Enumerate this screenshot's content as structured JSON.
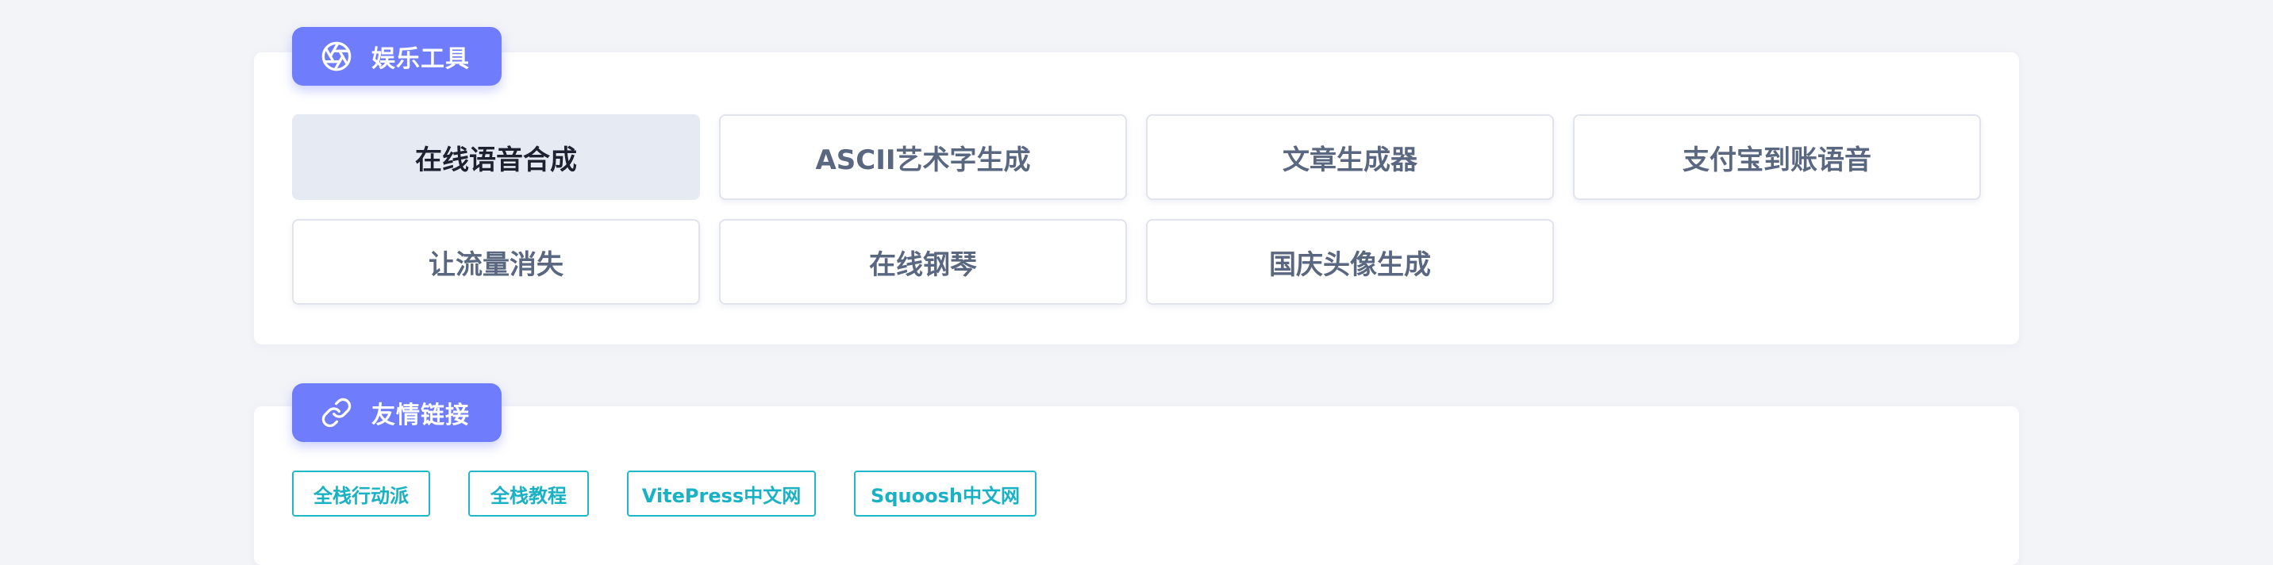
{
  "entertainment": {
    "title": "娱乐工具",
    "icon": "aperture-icon",
    "items": [
      {
        "label": "在线语音合成",
        "active": true
      },
      {
        "label": "ASCII艺术字生成"
      },
      {
        "label": "文章生成器"
      },
      {
        "label": "支付宝到账语音"
      },
      {
        "label": "让流量消失"
      },
      {
        "label": "在线钢琴"
      },
      {
        "label": "国庆头像生成"
      }
    ]
  },
  "links": {
    "title": "友情链接",
    "icon": "link-icon",
    "items": [
      {
        "label": "全栈行动派"
      },
      {
        "label": "全栈教程"
      },
      {
        "label": "VitePress中文网"
      },
      {
        "label": "Squoosh中文网"
      }
    ]
  },
  "colors": {
    "accent": "#6f7cfb",
    "link": "#1fb8c8",
    "page_bg": "#f3f4f8"
  }
}
